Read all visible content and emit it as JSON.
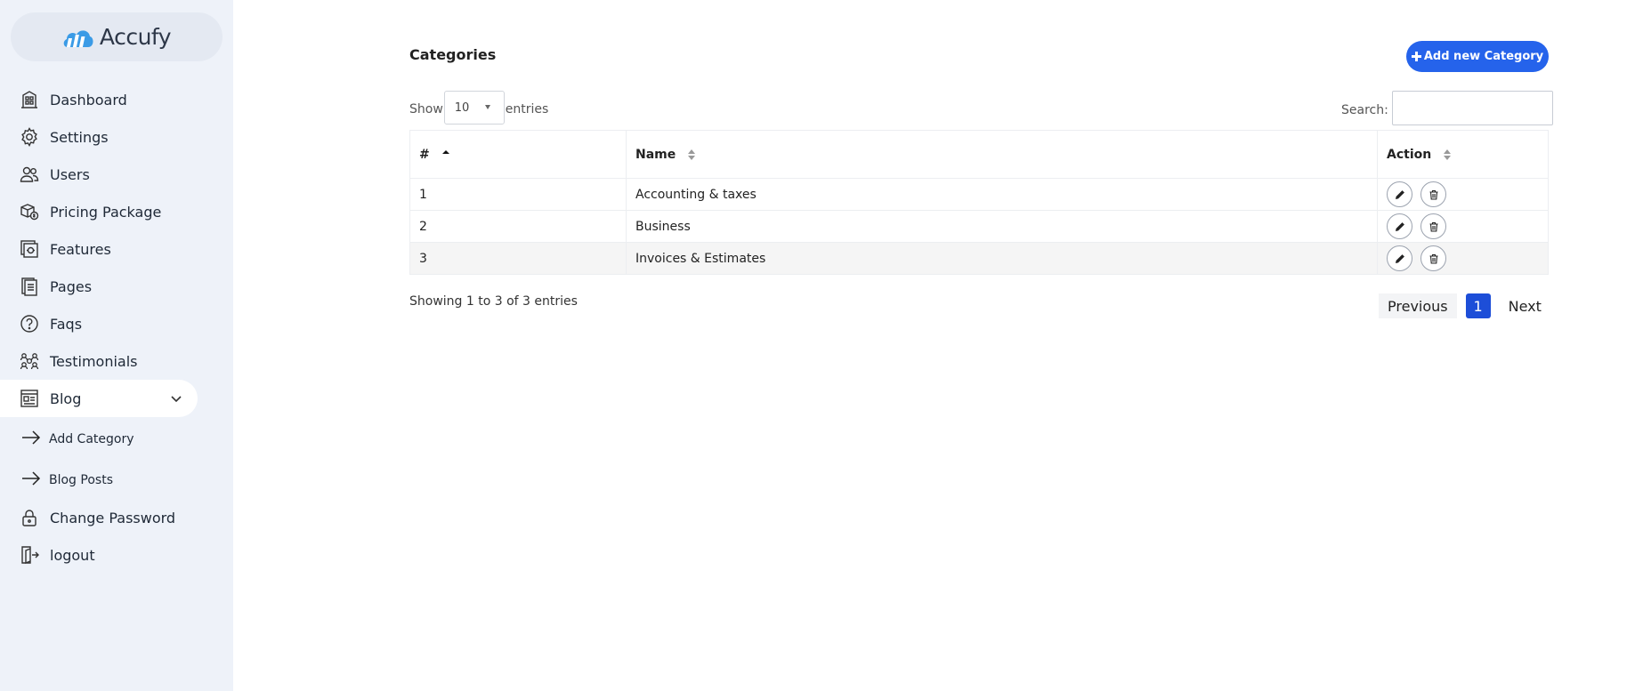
{
  "brand": {
    "name": "Accufy"
  },
  "sidebar": {
    "items": [
      {
        "label": "Dashboard",
        "icon": "building-icon"
      },
      {
        "label": "Settings",
        "icon": "gear-icon"
      },
      {
        "label": "Users",
        "icon": "users-icon"
      },
      {
        "label": "Pricing Package",
        "icon": "package-icon"
      },
      {
        "label": "Features",
        "icon": "features-icon"
      },
      {
        "label": "Pages",
        "icon": "pages-icon"
      },
      {
        "label": "Faqs",
        "icon": "question-icon"
      },
      {
        "label": "Testimonials",
        "icon": "group-icon"
      },
      {
        "label": "Blog",
        "icon": "blog-icon"
      }
    ],
    "blog_sub": [
      {
        "label": "Add Category",
        "icon": "arrow-right-icon"
      },
      {
        "label": "Blog Posts",
        "icon": "arrow-right-icon"
      }
    ],
    "bottom": [
      {
        "label": "Change Password",
        "icon": "lock-icon"
      },
      {
        "label": "logout",
        "icon": "logout-icon"
      }
    ]
  },
  "main": {
    "title": "Categories",
    "add_button": "Add new Category",
    "show_label": "Show",
    "entries_value": "10",
    "entries_label": "entries",
    "search_label": "Search:",
    "search_value": "",
    "columns": [
      "#",
      "Name",
      "Action"
    ],
    "rows": [
      {
        "num": "1",
        "name": "Accounting & taxes"
      },
      {
        "num": "2",
        "name": "Business"
      },
      {
        "num": "3",
        "name": "Invoices & Estimates"
      }
    ],
    "info": "Showing 1 to 3 of 3 entries",
    "pagination": {
      "previous": "Previous",
      "current": "1",
      "next": "Next"
    }
  },
  "colors": {
    "accent": "#2563eb",
    "sidebar_bg": "#eef2f9"
  }
}
